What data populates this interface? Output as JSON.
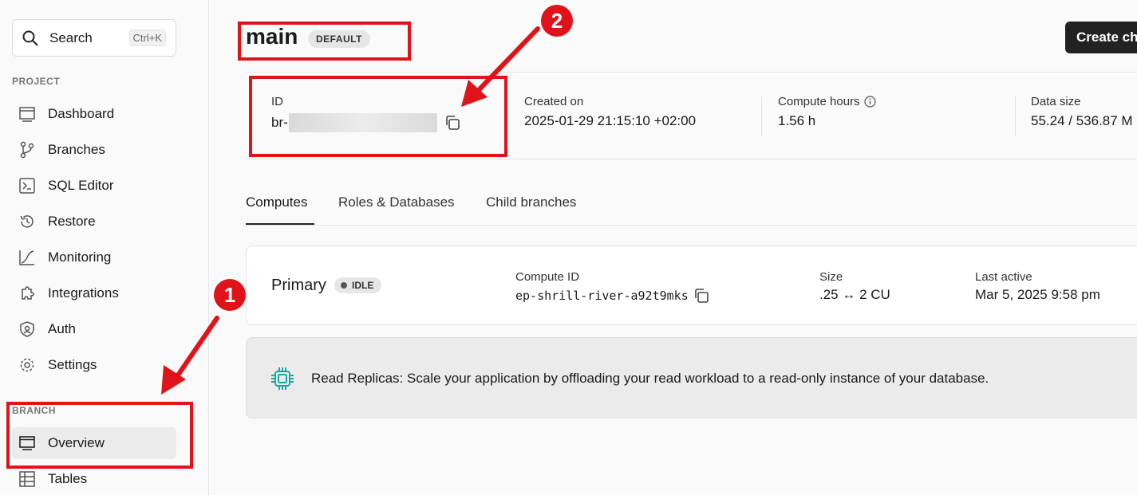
{
  "sidebar": {
    "search": {
      "label": "Search",
      "shortcut": "Ctrl+K"
    },
    "project_label": "PROJECT",
    "project_items": [
      {
        "label": "Dashboard",
        "icon": "dashboard-icon"
      },
      {
        "label": "Branches",
        "icon": "branch-icon"
      },
      {
        "label": "SQL Editor",
        "icon": "terminal-icon"
      },
      {
        "label": "Restore",
        "icon": "history-icon"
      },
      {
        "label": "Monitoring",
        "icon": "chart-icon"
      },
      {
        "label": "Integrations",
        "icon": "puzzle-icon"
      },
      {
        "label": "Auth",
        "icon": "shield-icon"
      },
      {
        "label": "Settings",
        "icon": "gear-icon"
      }
    ],
    "branch_label": "BRANCH",
    "branch_items": [
      {
        "label": "Overview",
        "icon": "monitor-icon",
        "active": true
      },
      {
        "label": "Tables",
        "icon": "table-icon"
      }
    ]
  },
  "header": {
    "title": "main",
    "badge": "DEFAULT",
    "create_button": "Create ch"
  },
  "info": {
    "id_label": "ID",
    "id_prefix": "br-",
    "created_label": "Created on",
    "created_value": "2025-01-29 21:15:10 +02:00",
    "compute_hours_label": "Compute hours",
    "compute_hours_value": "1.56 h",
    "data_size_label": "Data size",
    "data_size_value": "55.24 / 536.87 M"
  },
  "tabs": [
    {
      "label": "Computes",
      "active": true
    },
    {
      "label": "Roles & Databases"
    },
    {
      "label": "Child branches"
    }
  ],
  "compute": {
    "name": "Primary",
    "status": "IDLE",
    "compute_id_label": "Compute ID",
    "compute_id_value": "ep-shrill-river-a92t9mks",
    "size_label": "Size",
    "size_value": ".25 ↔ 2 CU",
    "last_active_label": "Last active",
    "last_active_value": "Mar 5, 2025 9:58 pm"
  },
  "replica_banner": {
    "text": "Read Replicas: Scale your application by offloading your read workload to a read-only instance of your database."
  },
  "annotations": {
    "step1": "1",
    "step2": "2",
    "color": "#e0121a"
  },
  "colors": {
    "accent_teal": "#1aa7a0",
    "button_dark": "#222222"
  }
}
